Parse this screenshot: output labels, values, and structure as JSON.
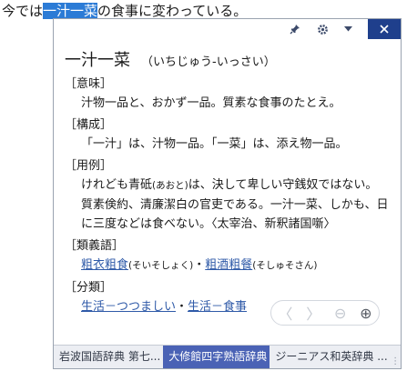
{
  "document": {
    "before": "今では",
    "selected": "一汁一菜",
    "after": "の食事に変わっている。"
  },
  "toolbar": {
    "pin_icon": "pin-icon",
    "settings_icon": "gear-icon",
    "menu_icon": "chevron-down-icon",
    "close_icon": "close-icon"
  },
  "entry": {
    "headword": "一汁一菜",
    "reading": "（いちじゅう-いっさい）",
    "meaning_label": "［意味］",
    "meaning": "汁物一品と、おかず一品。質素な食事のたとえ。",
    "structure_label": "［構成］",
    "structure": "「一汁」は、汁物一品。「一菜」は、添え物一品。",
    "example_label": "［用例］",
    "example_p1": "けれども青砥",
    "example_ruby": "(あおと)",
    "example_p2": "は、決して卑しい守銭奴ではない。質素倹約、清廉潔白の官吏である。一汁一菜、しかも、日に三度などは食べない。〈太宰治、新釈諸国噺〉",
    "synonyms_label": "［類義語］",
    "synonym1": "粗衣粗食",
    "synonym1_reading": "(そいそしょく)",
    "separator": "・",
    "synonym2": "粗酒粗餐",
    "synonym2_reading": "(そしゅそさん)",
    "category_label": "［分類］",
    "category1": "生活－つつましい",
    "category2": "生活－食事"
  },
  "nav": {
    "back": "〈",
    "forward": "〉",
    "zoom_out": "⊖",
    "zoom_in": "⊕"
  },
  "tabs": [
    {
      "label": "岩波国語辞典 第七..."
    },
    {
      "label": "大修館四字熟語辞典"
    },
    {
      "label": "ジーニアス和英辞典 ..."
    }
  ],
  "colors": {
    "selection": "#2b7bd6",
    "close_button": "#1f3f8c",
    "active_tab": "#4a62b5",
    "link": "#2f5aa8"
  }
}
